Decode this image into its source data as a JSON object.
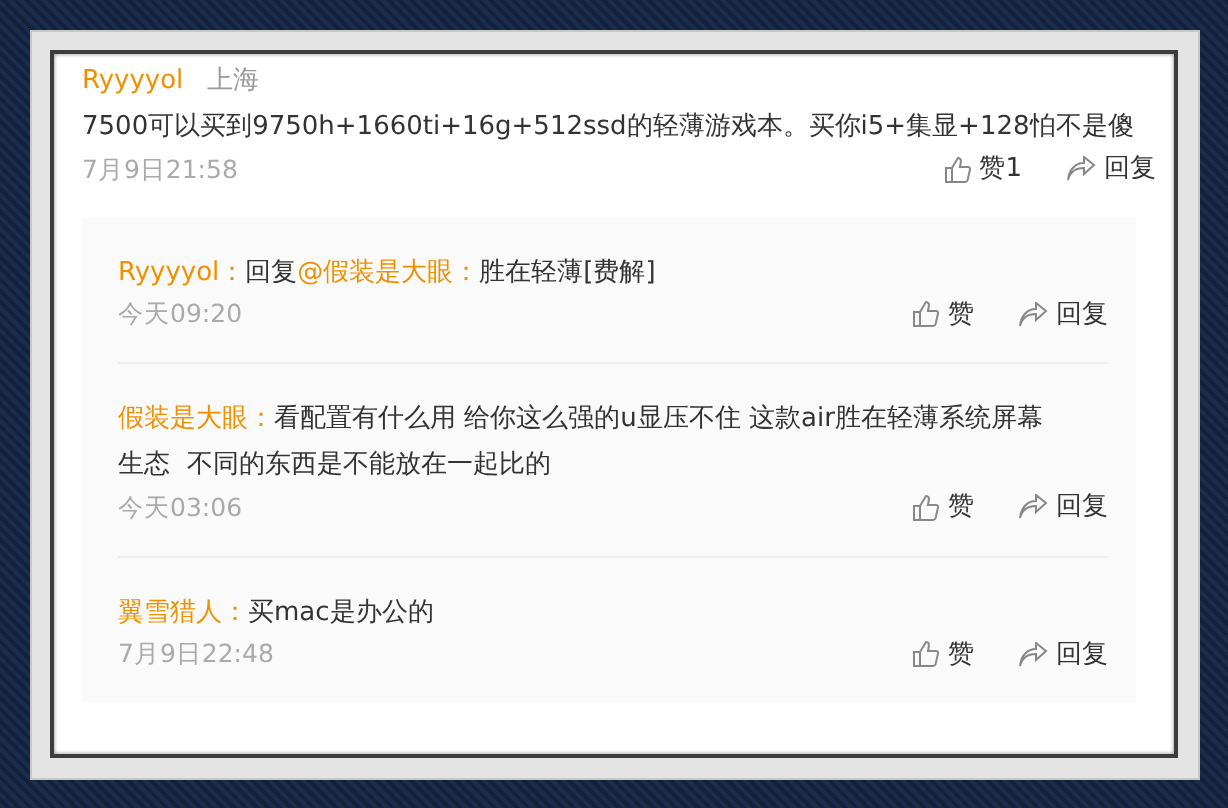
{
  "comment": {
    "author": "Ryyyyol",
    "location": "上海",
    "text": "7500可以买到9750h+1660ti+16g+512ssd的轻薄游戏本。买你i5+集显+128怕不是傻",
    "time": "7月9日21:58",
    "like": "赞1",
    "reply": "回复"
  },
  "replies": [
    {
      "author": "Ryyyyol：",
      "parts": [
        {
          "kind": "text",
          "text": "回复"
        },
        {
          "kind": "mention",
          "text": "@假装是大眼："
        },
        {
          "kind": "text",
          "text": "胜在轻薄[费解]"
        }
      ],
      "time": "今天09:20",
      "like": "赞",
      "reply": "回复"
    },
    {
      "author": "假装是大眼：",
      "parts": [
        {
          "kind": "text",
          "text": "看配置有什么用 给你这么强的u显压不住 这款air胜在轻薄系统屏幕生态  不同的东西是不能放在一起比的"
        }
      ],
      "time": "今天03:06",
      "like": "赞",
      "reply": "回复"
    },
    {
      "author": "翼雪猎人：",
      "parts": [
        {
          "kind": "text",
          "text": "买mac是办公的"
        }
      ],
      "time": "7月9日22:48",
      "like": "赞",
      "reply": "回复"
    }
  ]
}
